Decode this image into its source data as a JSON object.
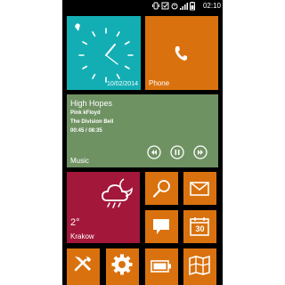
{
  "status_bar": {
    "time": "02:10",
    "icons": [
      "vibrate-icon",
      "sync-icon",
      "alarm-icon",
      "signal-icon",
      "battery-icon"
    ]
  },
  "tiles": {
    "clock": {
      "date": "10/02/2014",
      "color": "#13aeb3"
    },
    "phone": {
      "label": "Phone",
      "color": "#d9720e"
    },
    "music": {
      "song": "High Hopes",
      "artist": "Pink kFloyd",
      "album": "The Division Bell",
      "progress": "00:45 / 08:35",
      "label": "Music",
      "color": "#6f9263"
    },
    "weather": {
      "temperature": "2°",
      "city": "Krakow",
      "color": "#a3173b"
    },
    "search": {
      "icon": "search-icon"
    },
    "mail": {
      "icon": "mail-icon"
    },
    "messaging": {
      "icon": "speech-bubble-icon"
    },
    "calendar": {
      "day": "30",
      "icon": "calendar-icon"
    },
    "settings_tools": {
      "icon": "wrench-icon"
    },
    "settings": {
      "icon": "gear-icon"
    },
    "battery": {
      "icon": "battery-icon"
    },
    "maps": {
      "icon": "map-icon"
    }
  },
  "colors": {
    "accent": "#d9720e",
    "background": "#000000"
  }
}
